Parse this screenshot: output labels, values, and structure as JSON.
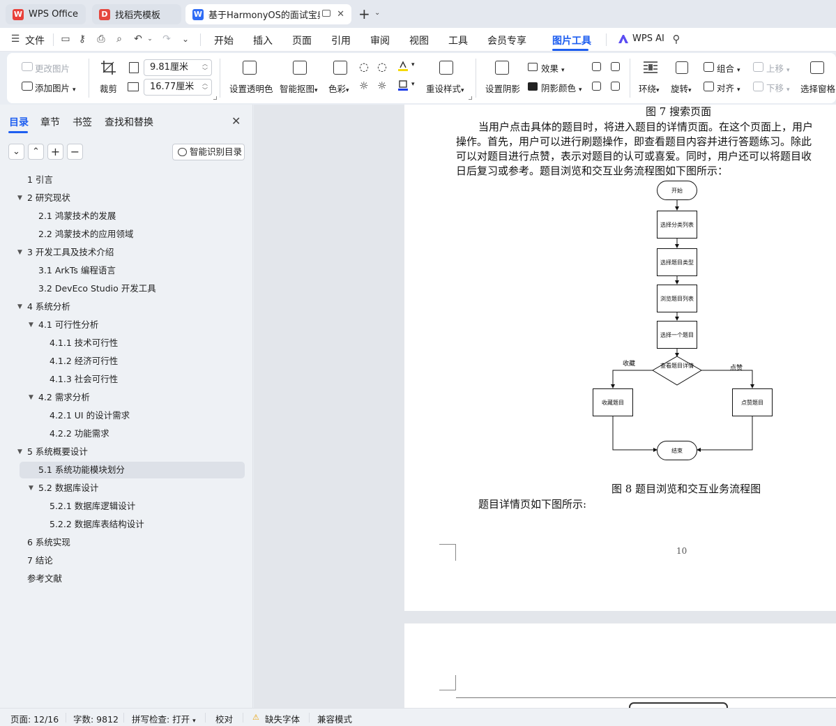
{
  "tabs": [
    {
      "label": "WPS Office",
      "logo": "W"
    },
    {
      "label": "找稻壳模板",
      "logo": "D"
    },
    {
      "label": "基于HarmonyOS的面试宝典a",
      "logo": "W"
    }
  ],
  "menu": {
    "file": "文件",
    "items": [
      "开始",
      "插入",
      "页面",
      "引用",
      "审阅",
      "视图",
      "工具",
      "会员专享",
      "图片工具"
    ],
    "wps_ai": "WPS AI"
  },
  "ribbon": {
    "change_image": "更改图片",
    "add_image": "添加图片",
    "crop": "裁剪",
    "height_value": "9.81厘米",
    "width_value": "16.77厘米",
    "set_transparent": "设置透明色",
    "smart_cutout": "智能抠图",
    "color": "色彩",
    "reset_style": "重设样式",
    "set_shadow": "设置阴影",
    "effect": "效果",
    "shadow_color": "阴影颜色",
    "wrap": "环绕",
    "rotate": "旋转",
    "group": "组合",
    "align": "对齐",
    "move_up": "上移",
    "move_down": "下移",
    "select_pane": "选择窗格"
  },
  "left_panel": {
    "tabs": [
      "目录",
      "章节",
      "书签",
      "查找和替换"
    ],
    "smart_toc": "智能识别目录",
    "toc": [
      {
        "label": "1  引言",
        "level": 1
      },
      {
        "label": "2  研究现状",
        "level": 1,
        "expanded": true
      },
      {
        "label": "2.1  鸿蒙技术的发展",
        "level": 2
      },
      {
        "label": "2.2 鸿蒙技术的应用领域",
        "level": 2
      },
      {
        "label": "3  开发工具及技术介绍",
        "level": 1,
        "expanded": true
      },
      {
        "label": "3.1 ArkTs 编程语言",
        "level": 2
      },
      {
        "label": "3.2 DevEco Studio 开发工具",
        "level": 2
      },
      {
        "label": "4  系统分析",
        "level": 1,
        "expanded": true
      },
      {
        "label": "4.1  可行性分析",
        "level": 2,
        "expanded": true
      },
      {
        "label": "4.1.1  技术可行性",
        "level": 3
      },
      {
        "label": "4.1.2  经济可行性",
        "level": 3
      },
      {
        "label": "4.1.3  社会可行性",
        "level": 3
      },
      {
        "label": "4.2  需求分析",
        "level": 2,
        "expanded": true
      },
      {
        "label": "4.2.1 UI 的设计需求",
        "level": 3
      },
      {
        "label": "4.2.2  功能需求",
        "level": 3
      },
      {
        "label": "5  系统概要设计",
        "level": 1,
        "expanded": true
      },
      {
        "label": "5.1  系统功能模块划分",
        "level": 2,
        "selected": true
      },
      {
        "label": "5.2 数据库设计",
        "level": 2,
        "expanded": true
      },
      {
        "label": "5.2.1 数据库逻辑设计",
        "level": 3
      },
      {
        "label": "5.2.2  数据库表结构设计",
        "level": 3
      },
      {
        "label": "6  系统实现",
        "level": 1
      },
      {
        "label": "7  结论",
        "level": 1
      },
      {
        "label": "参考文献",
        "level": 1
      }
    ]
  },
  "document": {
    "fig7_caption": "图 7  搜索页面",
    "para1": [
      "当用户点击具体的题目时，将进入题目的详情页面。在这个页面上，用户",
      "操作。首先，用户可以进行刷题操作，即查看题目内容并进行答题练习。除此",
      "可以对题目进行点赞，表示对题目的认可或喜爱。同时，用户还可以将题目收",
      "日后复习或参考。题目浏览和交互业务流程图如下图所示："
    ],
    "flowchart": {
      "start": "开始",
      "step1": "选择分类列表",
      "step2": "选择题目类型",
      "step3": "浏览题目列表",
      "step4": "选择一个题目",
      "decision": "查看题目详情",
      "left_branch_label": "收藏",
      "right_branch_label": "点赞",
      "left_box": "收藏题目",
      "right_box": "点赞题目",
      "end": "结束"
    },
    "fig8_caption": "图 8  题目浏览和交互业务流程图",
    "para2": "题目详情页如下图所示:",
    "page_number": "10"
  },
  "status": {
    "page": "页面: 12/16",
    "word_count": "字数: 9812",
    "spell_check": "拼写检查: 打开",
    "proof": "校对",
    "missing_font": "缺失字体",
    "compat_mode": "兼容模式"
  },
  "colors": {
    "accent": "#1e5ef0",
    "wps_red": "#e8403a",
    "docer_red": "#e5483f",
    "writer_blue": "#2f6cf5"
  }
}
